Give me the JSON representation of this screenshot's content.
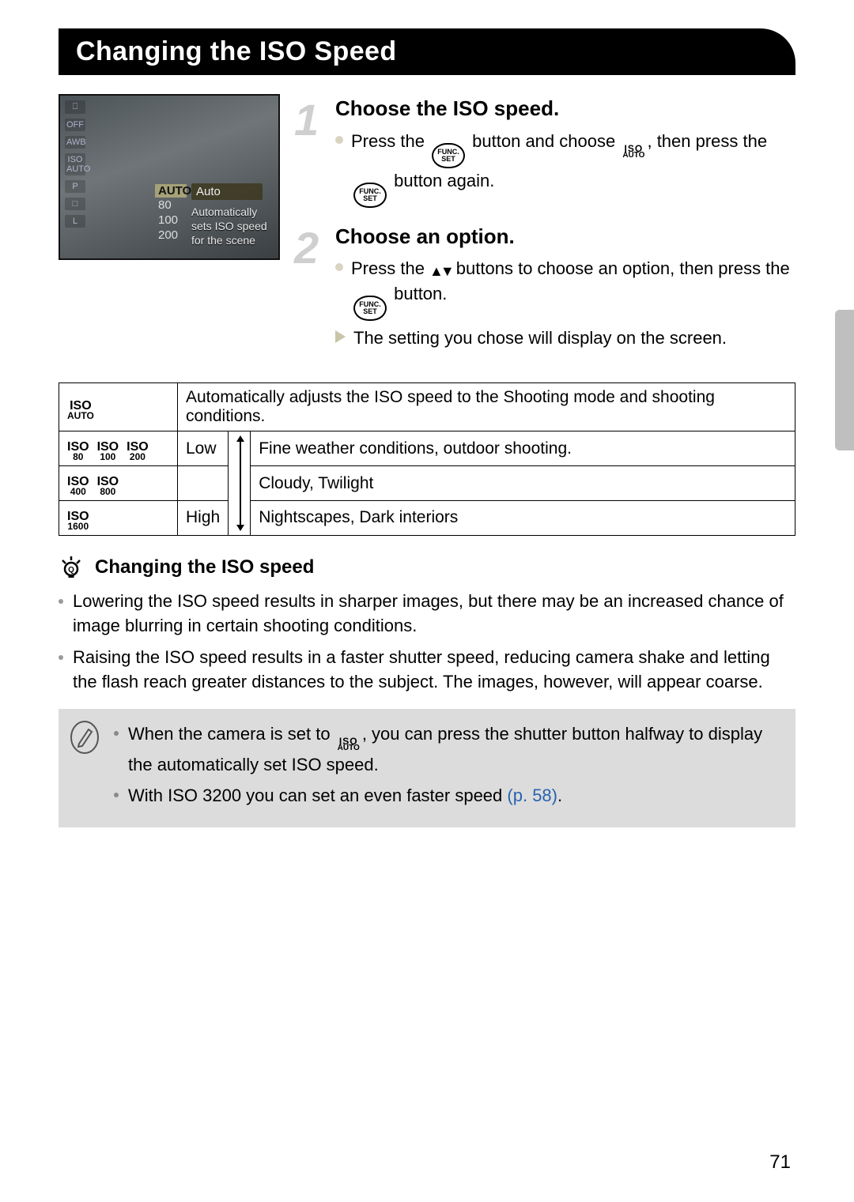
{
  "title": "Changing the ISO Speed",
  "lcd": {
    "left_icons": [
      "⎕",
      "OFF",
      "AWB",
      "ISO\nAUTO",
      "P",
      "□",
      "L"
    ],
    "menu_label_auto": "AUTO",
    "menu_items": [
      "80",
      "100",
      "200"
    ],
    "auto_label": "Auto",
    "auto_desc": "Automatically sets ISO speed for the scene"
  },
  "steps": [
    {
      "num": "1",
      "title": "Choose the ISO speed.",
      "lines": [
        {
          "type": "dot",
          "parts": [
            "Press the ",
            {
              "func": true
            },
            " button and choose ",
            {
              "iso": "AUTO"
            },
            ", then press the ",
            {
              "func": true
            },
            " button again."
          ]
        }
      ]
    },
    {
      "num": "2",
      "title": "Choose an option.",
      "lines": [
        {
          "type": "dot",
          "parts": [
            "Press the ",
            {
              "updown": true
            },
            " buttons to choose an option, then press the ",
            {
              "func": true
            },
            " button."
          ]
        },
        {
          "type": "arrow",
          "parts": [
            "The setting you chose will display on the screen."
          ]
        }
      ]
    }
  ],
  "table": {
    "rows": [
      {
        "icons": [
          {
            "sub": "AUTO"
          }
        ],
        "scale": "",
        "desc": "Automatically adjusts the ISO speed to the Shooting mode and shooting conditions."
      },
      {
        "icons": [
          {
            "sub": "80"
          },
          {
            "sub": "100"
          },
          {
            "sub": "200"
          }
        ],
        "scale": "Low",
        "desc": "Fine weather conditions, outdoor shooting."
      },
      {
        "icons": [
          {
            "sub": "400"
          },
          {
            "sub": "800"
          }
        ],
        "scale": "",
        "desc": "Cloudy, Twilight"
      },
      {
        "icons": [
          {
            "sub": "1600"
          }
        ],
        "scale": "High",
        "desc": "Nightscapes, Dark interiors"
      }
    ]
  },
  "tip": {
    "heading": "Changing the ISO speed",
    "bullets": [
      "Lowering the ISO speed results in sharper images, but there may be an increased chance of image blurring in certain shooting conditions.",
      "Raising the ISO speed results in a faster shutter speed, reducing camera shake and letting the flash reach greater distances to the subject. The images, however, will appear coarse."
    ]
  },
  "note": {
    "bullets": [
      {
        "pre": "When the camera is set to ",
        "iso": "AUTO",
        "post": ", you can press the shutter button halfway to display the automatically set ISO speed."
      },
      {
        "pre": "With ISO 3200 you can set an even faster speed ",
        "link": "(p. 58)",
        "post": "."
      }
    ]
  },
  "page_number": "71"
}
